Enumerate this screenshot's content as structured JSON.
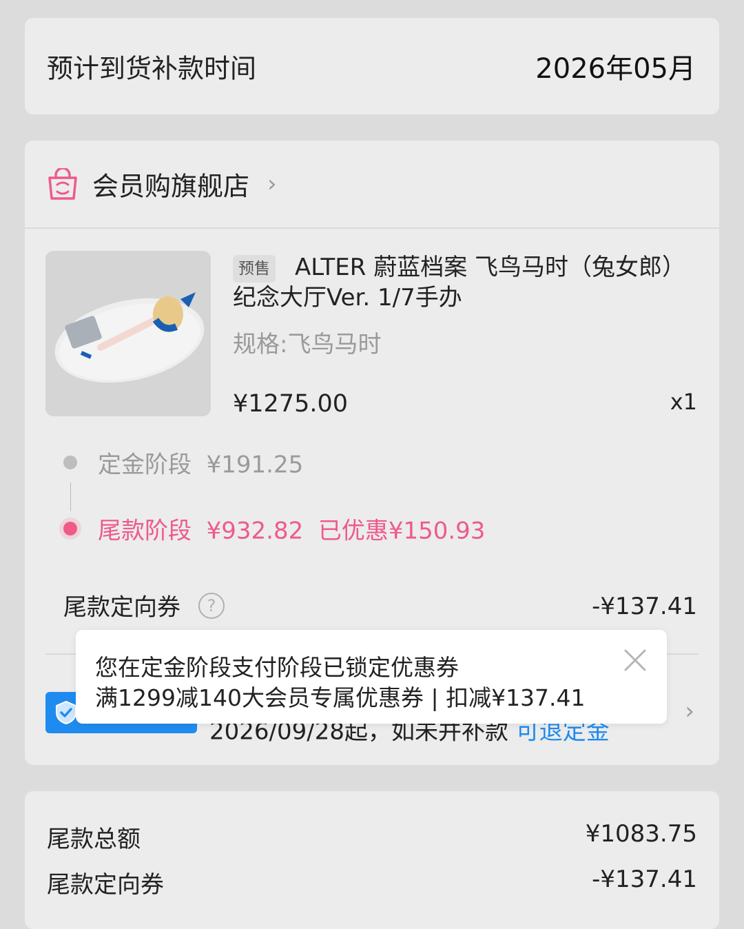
{
  "arrival": {
    "label": "预计到货补款时间",
    "value": "2026年05月"
  },
  "shop": {
    "name": "会员购旗舰店",
    "chevron": "›"
  },
  "product": {
    "tag": "预售",
    "title": "ALTER 蔚蓝档案 飞鸟马时（兔女郎）纪念大厅Ver. 1/7手办",
    "spec": "规格:飞鸟马时",
    "price": "¥1275.00",
    "qty": "x1"
  },
  "stages": {
    "deposit": "定金阶段  ¥191.25",
    "final": "尾款阶段  ¥932.82  已优惠¥150.93"
  },
  "coupon": {
    "label": "尾款定向券",
    "help": "?",
    "value": "-¥137.41"
  },
  "refund": {
    "text": "2026/09/28起，如未并补款",
    "link": "可退定金",
    "chevron": "›"
  },
  "tooltip": {
    "line1": "您在定金阶段支付阶段已锁定优惠券",
    "line2": "满1299减140大会员专属优惠券 | 扣减¥137.41"
  },
  "summary": {
    "rows": [
      {
        "label": "尾款总额",
        "value": "¥1083.75"
      },
      {
        "label": "尾款定向券",
        "value": "-¥137.41"
      }
    ]
  },
  "colors": {
    "pink": "#ee5a89",
    "blue": "#1f8bef",
    "gray_text": "#9a9a9a"
  }
}
